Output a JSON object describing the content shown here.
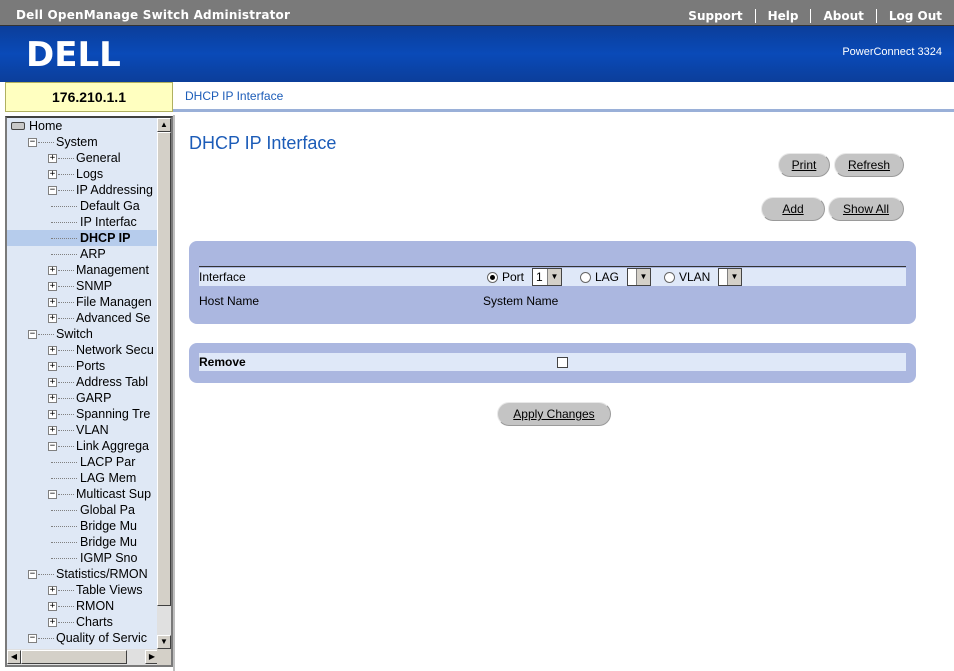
{
  "topbar": {
    "title": "Dell OpenManage Switch Administrator",
    "links": [
      "Support",
      "Help",
      "About",
      "Log Out"
    ]
  },
  "header": {
    "logo_text": "DELL",
    "model": "PowerConnect 3324"
  },
  "ip_address": "176.210.1.1",
  "breadcrumb": "DHCP IP Interface",
  "tree": [
    {
      "label": "Home",
      "level": 0,
      "type": "home"
    },
    {
      "label": "System",
      "level": 1,
      "type": "minus"
    },
    {
      "label": "General",
      "level": 2,
      "type": "plus"
    },
    {
      "label": "Logs",
      "level": 2,
      "type": "plus"
    },
    {
      "label": "IP Addressing",
      "level": 2,
      "type": "minus"
    },
    {
      "label": "Default Ga",
      "level": 3,
      "type": "leaf"
    },
    {
      "label": "IP Interfac",
      "level": 3,
      "type": "leaf"
    },
    {
      "label": "DHCP IP",
      "level": 3,
      "type": "leaf",
      "selected": true
    },
    {
      "label": "ARP",
      "level": 3,
      "type": "leaf"
    },
    {
      "label": "Management",
      "level": 2,
      "type": "plus"
    },
    {
      "label": "SNMP",
      "level": 2,
      "type": "plus"
    },
    {
      "label": "File Managen",
      "level": 2,
      "type": "plus"
    },
    {
      "label": "Advanced Se",
      "level": 2,
      "type": "plus"
    },
    {
      "label": "Switch",
      "level": 1,
      "type": "minus"
    },
    {
      "label": "Network Secu",
      "level": 2,
      "type": "plus"
    },
    {
      "label": "Ports",
      "level": 2,
      "type": "plus"
    },
    {
      "label": "Address Tabl",
      "level": 2,
      "type": "plus"
    },
    {
      "label": "GARP",
      "level": 2,
      "type": "plus"
    },
    {
      "label": "Spanning Tre",
      "level": 2,
      "type": "plus"
    },
    {
      "label": "VLAN",
      "level": 2,
      "type": "plus"
    },
    {
      "label": "Link Aggrega",
      "level": 2,
      "type": "minus"
    },
    {
      "label": "LACP Par",
      "level": 3,
      "type": "leaf"
    },
    {
      "label": "LAG Mem",
      "level": 3,
      "type": "leaf"
    },
    {
      "label": "Multicast Sup",
      "level": 2,
      "type": "minus"
    },
    {
      "label": "Global Pa",
      "level": 3,
      "type": "leaf"
    },
    {
      "label": "Bridge Mu",
      "level": 3,
      "type": "leaf"
    },
    {
      "label": "Bridge Mu",
      "level": 3,
      "type": "leaf"
    },
    {
      "label": "IGMP Sno",
      "level": 3,
      "type": "leaf"
    },
    {
      "label": "Statistics/RMON",
      "level": 1,
      "type": "minus"
    },
    {
      "label": "Table Views",
      "level": 2,
      "type": "plus"
    },
    {
      "label": "RMON",
      "level": 2,
      "type": "plus"
    },
    {
      "label": "Charts",
      "level": 2,
      "type": "plus"
    },
    {
      "label": "Quality of Servic",
      "level": 1,
      "type": "minus"
    }
  ],
  "main": {
    "title": "DHCP IP Interface",
    "buttons": {
      "print": "Print",
      "refresh": "Refresh",
      "add": "Add",
      "show_all": "Show All",
      "apply": "Apply Changes"
    },
    "interface_label": "Interface",
    "port_label": "Port",
    "port_value": "1",
    "lag_label": "LAG",
    "lag_value": "",
    "vlan_label": "VLAN",
    "vlan_value": "",
    "host_name_label": "Host Name",
    "host_name_value": "System Name",
    "remove_label": "Remove"
  }
}
